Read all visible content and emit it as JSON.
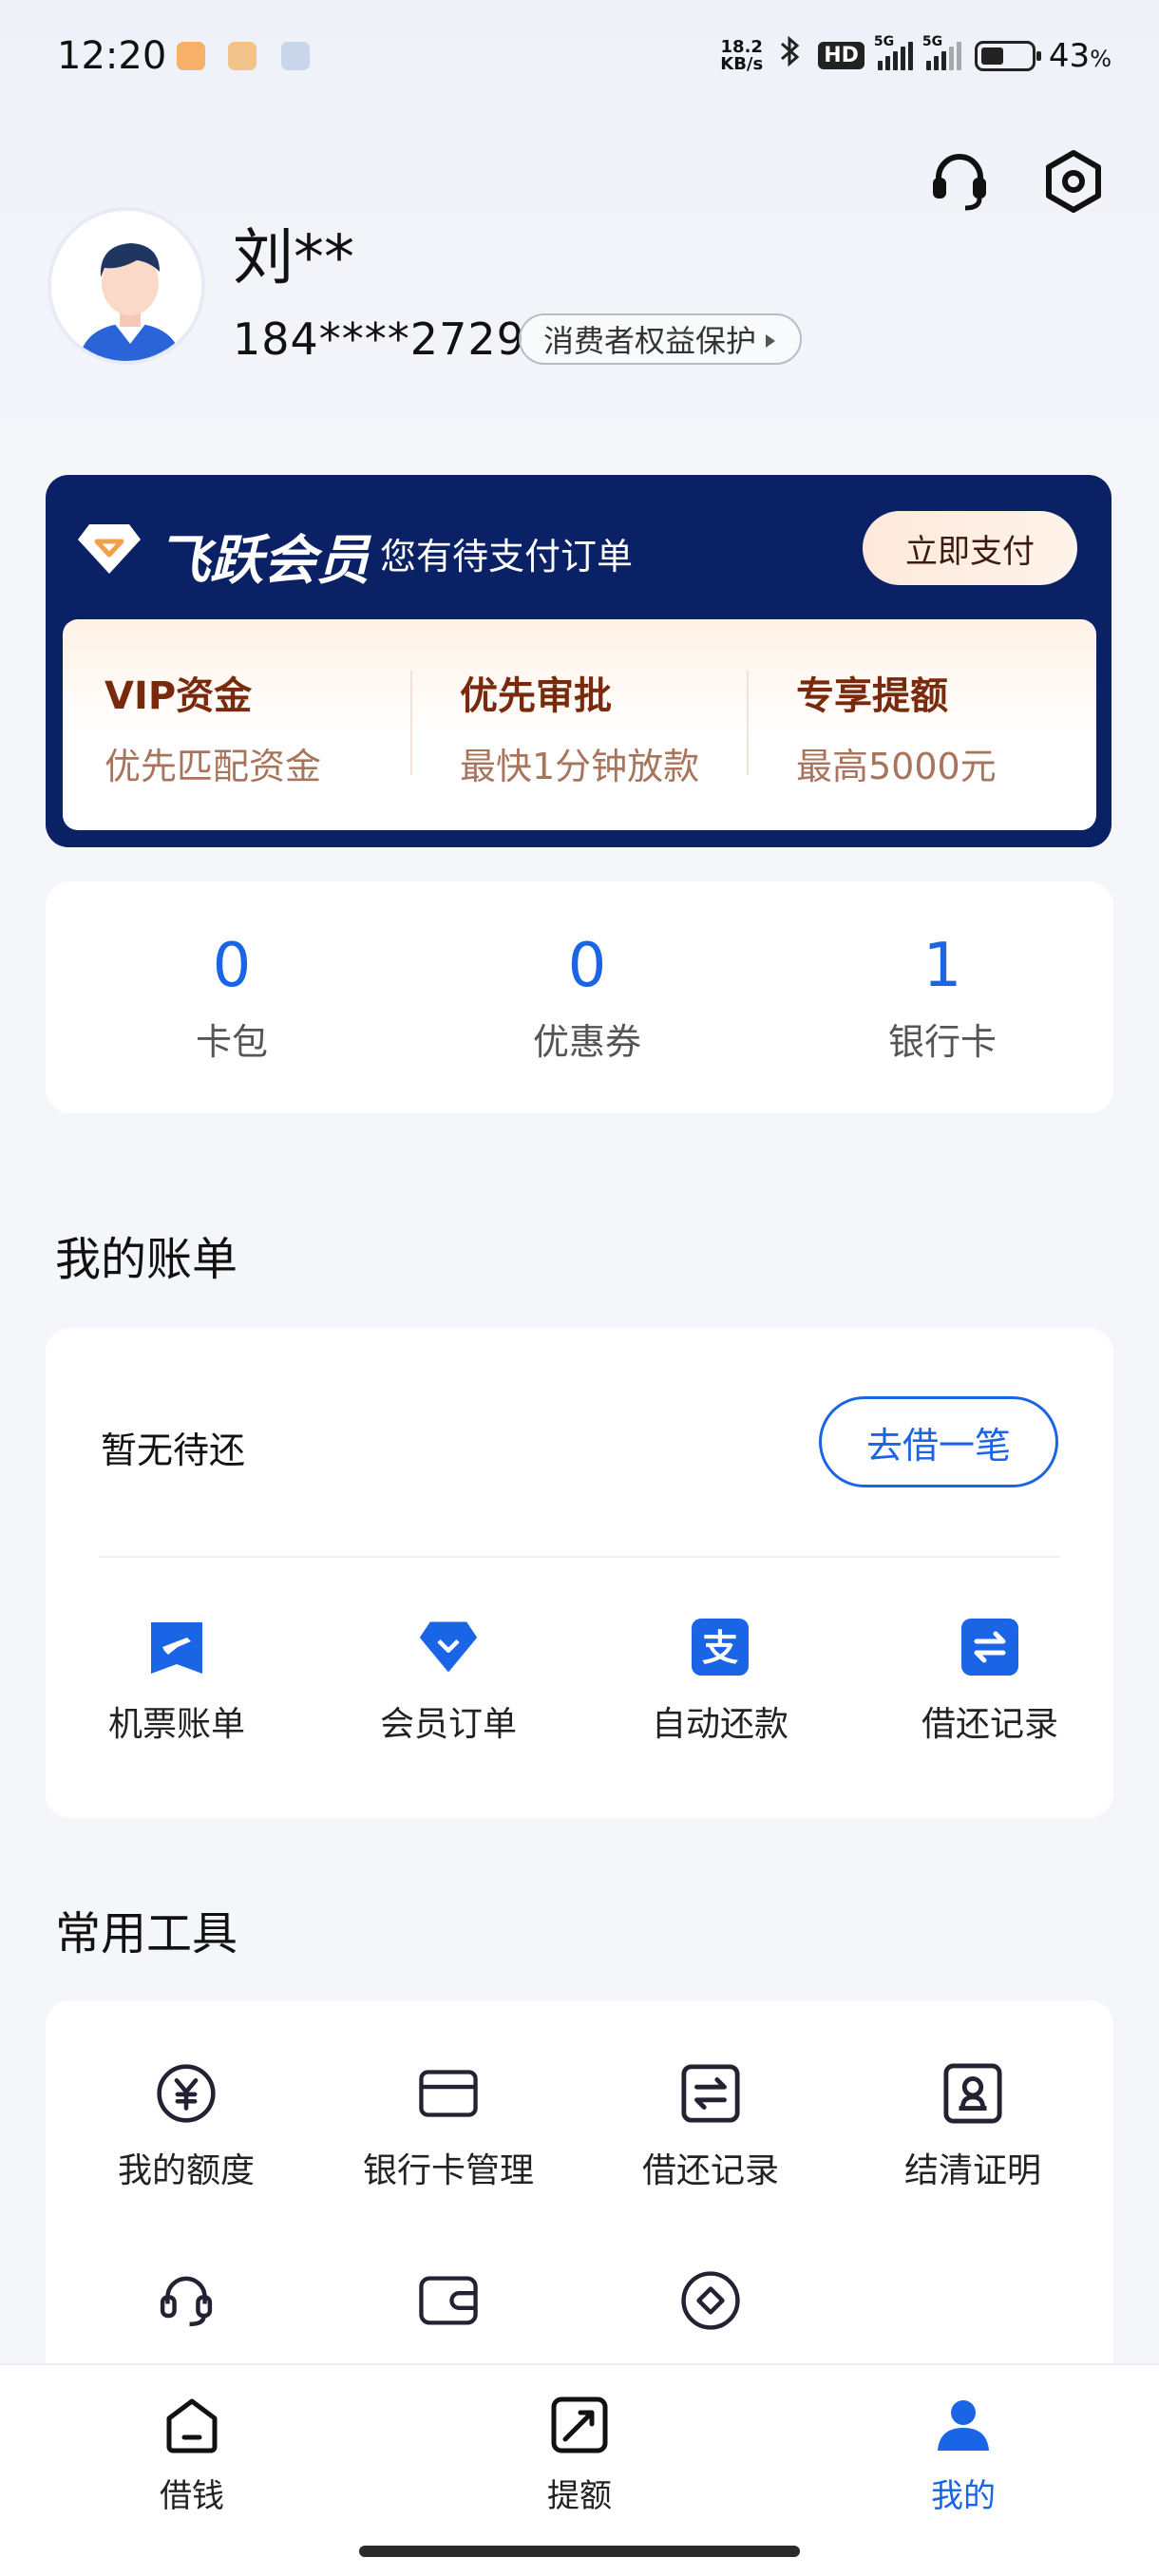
{
  "status_bar": {
    "time": "12:20",
    "net_speed_value": "18.2",
    "net_speed_unit": "KB/s",
    "hd": "HD",
    "net1": "5G",
    "net2": "5G",
    "battery_percent": "43",
    "battery_unit": "%"
  },
  "profile": {
    "name": "刘**",
    "phone": "184****2729",
    "protection_label": "消费者权益保护"
  },
  "vip": {
    "title": "飞跃会员",
    "subtitle": "您有待支付订单",
    "pay_button": "立即支付",
    "features": [
      {
        "title": "VIP资金",
        "desc": "优先匹配资金"
      },
      {
        "title": "优先审批",
        "desc": "最快1分钟放款"
      },
      {
        "title": "专享提额",
        "desc": "最高5000元"
      }
    ]
  },
  "counts": [
    {
      "value": "0",
      "label": "卡包"
    },
    {
      "value": "0",
      "label": "优惠券"
    },
    {
      "value": "1",
      "label": "银行卡"
    }
  ],
  "bills": {
    "section_title": "我的账单",
    "status": "暂无待还",
    "borrow_button": "去借一笔",
    "items": [
      {
        "icon": "plane-icon",
        "label": "机票账单"
      },
      {
        "icon": "diamond-icon",
        "label": "会员订单"
      },
      {
        "icon": "alipay-icon",
        "label": "自动还款"
      },
      {
        "icon": "exchange-icon",
        "label": "借还记录"
      }
    ]
  },
  "tools": {
    "section_title": "常用工具",
    "items": [
      {
        "icon": "yen-icon",
        "label": "我的额度"
      },
      {
        "icon": "bank-card-icon",
        "label": "银行卡管理"
      },
      {
        "icon": "exchange-icon",
        "label": "借还记录"
      },
      {
        "icon": "certificate-icon",
        "label": "结清证明"
      },
      {
        "icon": "headset-icon",
        "label": ""
      },
      {
        "icon": "wallet-icon",
        "label": ""
      },
      {
        "icon": "compass-icon",
        "label": ""
      }
    ]
  },
  "bottom_nav": [
    {
      "icon": "home-icon",
      "label": "借钱"
    },
    {
      "icon": "quota-icon",
      "label": "提额"
    },
    {
      "icon": "person-icon",
      "label": "我的",
      "active": true
    }
  ],
  "colors": {
    "accent": "#1a64e6",
    "vip_bg": "#0a2166",
    "vip_text": "#7a2a0c"
  }
}
